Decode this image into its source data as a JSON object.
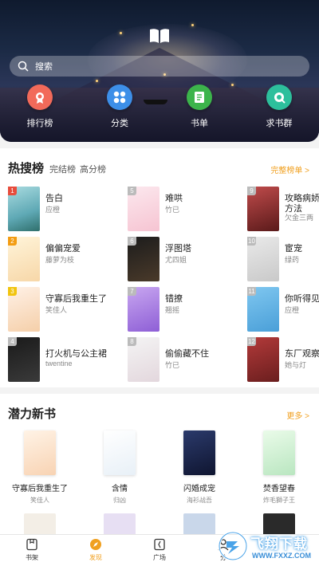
{
  "header": {
    "search_placeholder": "搜索",
    "quick_links": [
      {
        "label": "排行榜",
        "icon": "medal-icon",
        "color": "#f26a5a"
      },
      {
        "label": "分类",
        "icon": "category-grid-icon",
        "color": "#3d8fe8"
      },
      {
        "label": "书单",
        "icon": "booklist-icon",
        "color": "#3cb44b"
      },
      {
        "label": "求书群",
        "icon": "chat-group-icon",
        "color": "#2dbf9c"
      }
    ]
  },
  "hot": {
    "title": "热搜榜",
    "tabs": [
      "完结榜",
      "高分榜"
    ],
    "more": "完整榜单 >",
    "items": [
      {
        "rank": "1",
        "title": "告白",
        "author": "应橙"
      },
      {
        "rank": "5",
        "title": "难哄",
        "author": "竹已"
      },
      {
        "rank": "9",
        "title": "攻略病娇男主的正确",
        "title2": "方法",
        "author": "欠金三两"
      },
      {
        "rank": "2",
        "title": "偏偏宠爱",
        "author": "藤萝为枝"
      },
      {
        "rank": "6",
        "title": "浮图塔",
        "author": "尤四姐"
      },
      {
        "rank": "10",
        "title": "宦宠",
        "author": "绿药"
      },
      {
        "rank": "3",
        "title": "守寡后我重生了",
        "author": "笑佳人"
      },
      {
        "rank": "7",
        "title": "错撩",
        "author": "翘摇"
      },
      {
        "rank": "11",
        "title": "你听得见",
        "author": "应橙"
      },
      {
        "rank": "4",
        "title": "打火机与公主裙",
        "author": "twentine"
      },
      {
        "rank": "8",
        "title": "偷偷藏不住",
        "author": "竹已"
      },
      {
        "rank": "12",
        "title": "东厂观察笔记",
        "author": "她与灯"
      }
    ]
  },
  "potential": {
    "title": "潜力新书",
    "more": "更多 >",
    "books": [
      {
        "title": "守寡后我重生了",
        "author": "笑佳人"
      },
      {
        "title": "含情",
        "author": "归凶"
      },
      {
        "title": "闪婚成宠",
        "author": "海衫战吾"
      },
      {
        "title": "焚香望春",
        "author": "炸毛獅子王"
      }
    ]
  },
  "nav": {
    "items": [
      {
        "label": "书架",
        "icon": "bookshelf-icon"
      },
      {
        "label": "发现",
        "icon": "discover-icon"
      },
      {
        "label": "广场",
        "icon": "square-icon"
      },
      {
        "label": "分",
        "icon": "profile-icon"
      }
    ]
  },
  "watermark": {
    "brand": "飞翔下载",
    "url": "WWW.FXXZ.COM"
  }
}
